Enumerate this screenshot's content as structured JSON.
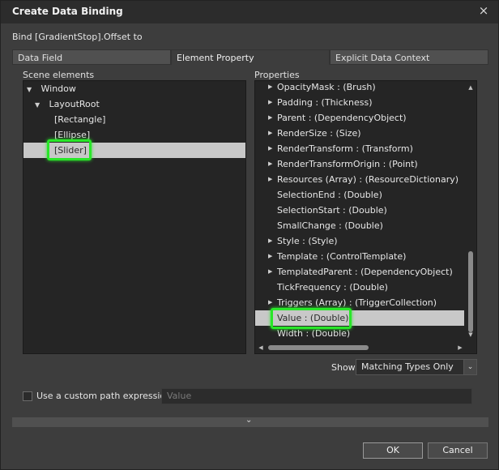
{
  "window": {
    "title": "Create Data Binding",
    "close_glyph": "×"
  },
  "bind_label": "Bind [GradientStop].Offset to",
  "tabs": [
    {
      "label": "Data Field"
    },
    {
      "label": "Element Property",
      "active": true
    },
    {
      "label": "Explicit Data Context"
    }
  ],
  "scene": {
    "label": "Scene elements",
    "items": [
      {
        "label": "Window",
        "arrow": "▼"
      },
      {
        "label": "LayoutRoot",
        "arrow": "▼"
      },
      {
        "label": "[Rectangle]"
      },
      {
        "label": "[Ellipse]"
      },
      {
        "label": "[Slider]",
        "selected": true
      }
    ]
  },
  "properties": {
    "label": "Properties",
    "items": [
      {
        "label": "OpacityMask : (Brush)",
        "expandable": true
      },
      {
        "label": "Padding : (Thickness)",
        "expandable": true
      },
      {
        "label": "Parent : (DependencyObject)",
        "expandable": true
      },
      {
        "label": "RenderSize : (Size)",
        "expandable": true
      },
      {
        "label": "RenderTransform : (Transform)",
        "expandable": true
      },
      {
        "label": "RenderTransformOrigin : (Point)",
        "expandable": true
      },
      {
        "label": "Resources (Array) : (ResourceDictionary)",
        "expandable": true
      },
      {
        "label": "SelectionEnd : (Double)",
        "expandable": false
      },
      {
        "label": "SelectionStart : (Double)",
        "expandable": false
      },
      {
        "label": "SmallChange : (Double)",
        "expandable": false
      },
      {
        "label": "Style : (Style)",
        "expandable": true
      },
      {
        "label": "Template : (ControlTemplate)",
        "expandable": true
      },
      {
        "label": "TemplatedParent : (DependencyObject)",
        "expandable": true
      },
      {
        "label": "TickFrequency : (Double)",
        "expandable": false
      },
      {
        "label": "Triggers (Array) : (TriggerCollection)",
        "expandable": true
      },
      {
        "label": "Value : (Double)",
        "expandable": false,
        "selected": true
      },
      {
        "label": "Width : (Double)",
        "expandable": false
      }
    ]
  },
  "show": {
    "label": "Show",
    "selected": "Matching Types Only",
    "chevron": "⌄"
  },
  "custom_path": {
    "label": "Use a custom path expression",
    "checked": false,
    "placeholder": "Value"
  },
  "buttons": {
    "ok": "OK",
    "cancel": "Cancel"
  },
  "colors": {
    "highlight": "#29e629",
    "selection": "#c8c8c8",
    "panel_bg": "#252525",
    "dialog_bg": "#3d3d3d"
  }
}
